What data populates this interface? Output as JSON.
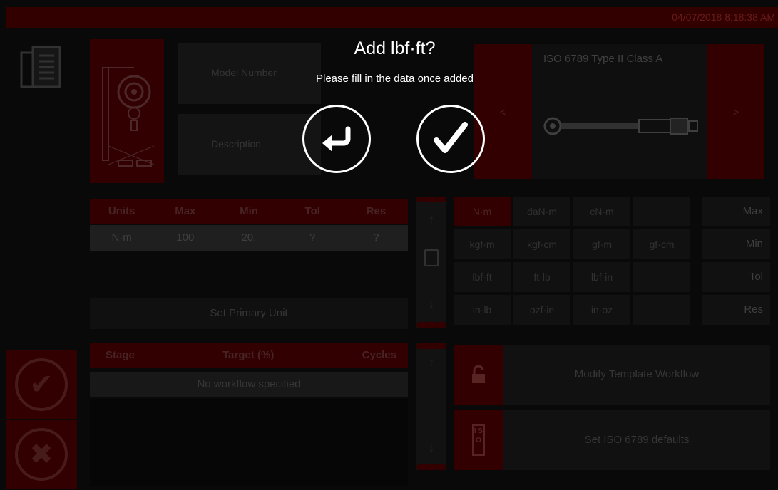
{
  "clock": "04/07/2018 8:18:38 AM",
  "form": {
    "model_label": "Model Number",
    "description_label": "Description"
  },
  "iso": {
    "title": "ISO 6789 Type II Class A",
    "prev": "<",
    "next": ">"
  },
  "units_table": {
    "headers": [
      "Units",
      "Max",
      "Min",
      "Tol",
      "Res"
    ],
    "row": [
      "N·m",
      "100",
      "20.",
      "?",
      "?"
    ],
    "set_primary": "Set Primary Unit"
  },
  "unit_grid": [
    [
      "N·m",
      "daN·m",
      "cN·m",
      ""
    ],
    [
      "kgf·m",
      "kgf·cm",
      "gf·m",
      "gf·cm"
    ],
    [
      "lbf·ft",
      "ft·lb",
      "lbf·in",
      ""
    ],
    [
      "in·lb",
      "ozf·in",
      "in·oz",
      ""
    ]
  ],
  "params": [
    "Max",
    "Min",
    "Tol",
    "Res"
  ],
  "workflow": {
    "headers": [
      "Stage",
      "Target (%)",
      "Cycles"
    ],
    "empty": "No workflow specified"
  },
  "actions": {
    "modify": "Modify Template Workflow",
    "iso_defaults": "Set ISO 6789 defaults",
    "iso_badge": "I S O"
  },
  "dialog": {
    "title": "Add lbf·ft?",
    "subtitle": "Please fill in the data once added"
  },
  "colors": {
    "accent": "#3b0000",
    "overlay_text": "#ffffff"
  }
}
